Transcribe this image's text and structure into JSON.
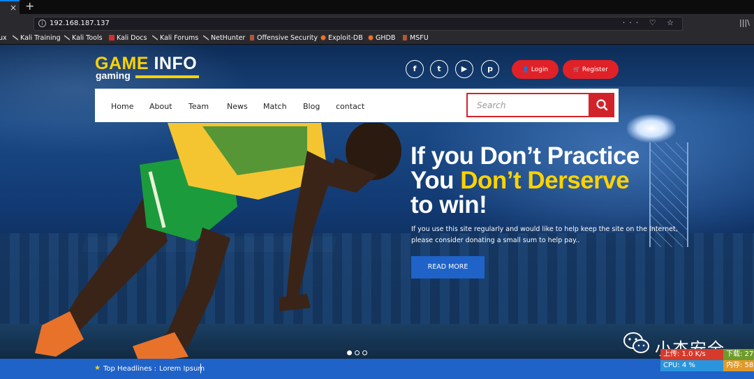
{
  "browser": {
    "tab_close_glyph": "×",
    "new_tab_glyph": "+",
    "url": "192.168.187.137",
    "info_glyph": "i",
    "url_actions": "··· ♡ ☆",
    "library_glyph": "|||\\"
  },
  "bookmarks": [
    {
      "label": "ux",
      "icon_color": "#2a2a2e"
    },
    {
      "label": "Kali Training",
      "icon_color": "#c9c9c9"
    },
    {
      "label": "Kali Tools",
      "icon_color": "#c9c9c9"
    },
    {
      "label": "Kali Docs",
      "icon_color": "#d0312d"
    },
    {
      "label": "Kali Forums",
      "icon_color": "#c9c9c9"
    },
    {
      "label": "NetHunter",
      "icon_color": "#c9c9c9"
    },
    {
      "label": "Offensive Security",
      "icon_color": "#b0563b"
    },
    {
      "label": "Exploit-DB",
      "icon_color": "#e8732a"
    },
    {
      "label": "GHDB",
      "icon_color": "#e8732a"
    },
    {
      "label": "MSFU",
      "icon_color": "#b0563b"
    }
  ],
  "site": {
    "logo": {
      "game": "GAME",
      "info": "INFO",
      "sub": "gaming"
    },
    "social": [
      {
        "name": "facebook",
        "glyph": "f"
      },
      {
        "name": "twitter",
        "glyph": "t"
      },
      {
        "name": "youtube",
        "glyph": "▶"
      },
      {
        "name": "pinterest",
        "glyph": "p"
      }
    ],
    "login_label": "Login",
    "login_glyph": "👤",
    "register_label": "Register",
    "register_glyph": "🛒",
    "menu": [
      "Home",
      "About",
      "Team",
      "News",
      "Match",
      "Blog",
      "contact"
    ],
    "search_placeholder": "Search",
    "hero": {
      "line1": "If you Don’t Practice",
      "line2_white": "You ",
      "line2_yellow": "Don’t Derserve",
      "line3": "to win!",
      "description": "If you use this site regularly and would like to help keep the site on the Internet, please consider donating a small sum to help pay..",
      "button": "READ MORE"
    },
    "slider": {
      "count": 3,
      "active": 1
    },
    "headlines_label": "Top Headlines :",
    "headlines_text": "Lorem Ipsum",
    "headlines_star": "★"
  },
  "watermark": {
    "text": "小杰安全"
  },
  "monitor": {
    "upload": "上传: 1.0 K/s",
    "download": "下载: 27",
    "cpu": "CPU: 4 %",
    "memory": "内存: 58"
  },
  "colors": {
    "brand_yellow": "#ffd200",
    "brand_red": "#e02127",
    "brand_blue": "#1f63c9",
    "browser_dark": "#2a2a2e"
  }
}
